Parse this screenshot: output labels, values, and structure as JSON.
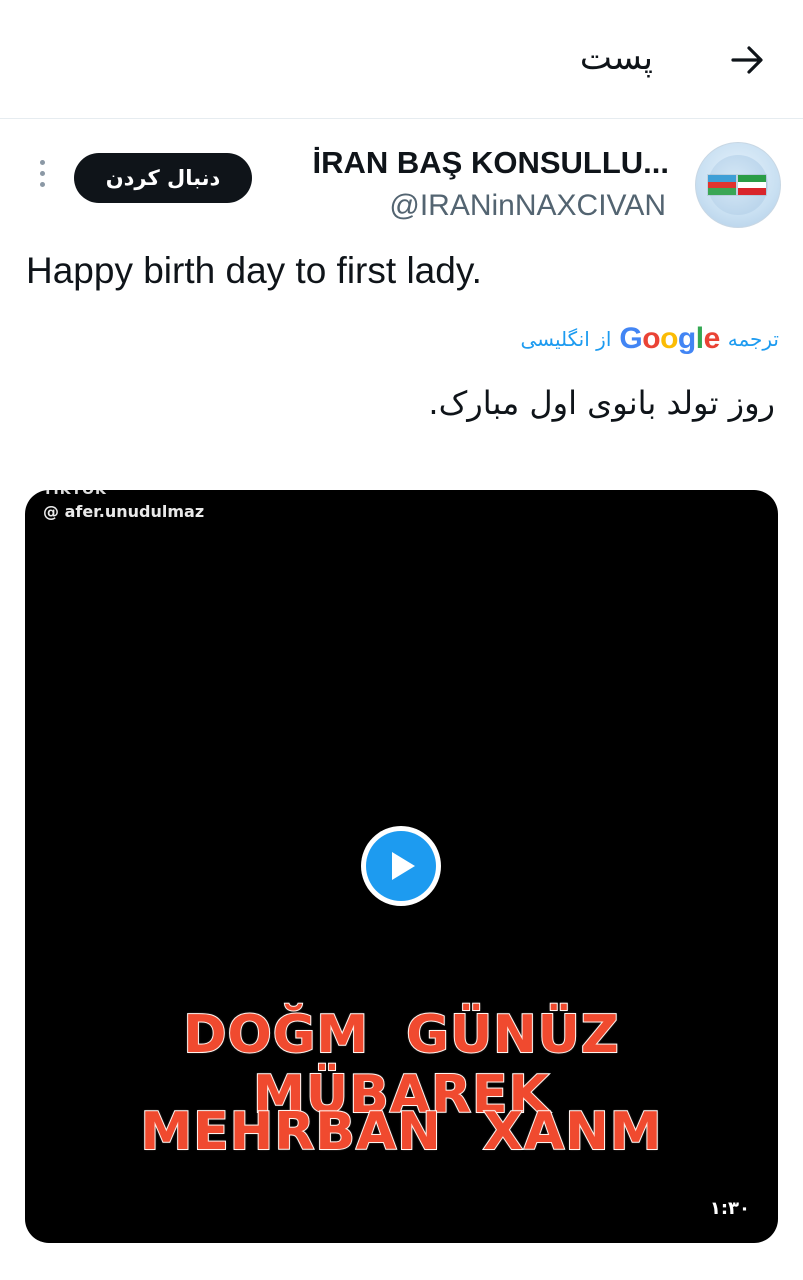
{
  "header": {
    "title": "پست",
    "back_icon": "arrow-right-icon"
  },
  "tweet": {
    "author_name": "İRAN BAŞ KONSULLU...",
    "author_handle": "@IRANinNAXCIVAN",
    "follow_label": "دنبال کردن",
    "more_icon": "more-vertical-icon",
    "text": "Happy birth day to first lady.",
    "translation": {
      "prefix": "ترجمه",
      "provider": "Google",
      "suffix": "از انگلیسی",
      "text": "روز تولد بانوی اول مبارک."
    },
    "media": {
      "watermark": "@ afer.unudulmaz",
      "top_cut_text": "TIKTOK",
      "caption_line1": "DOĞM GÜNÜZ MÜBAREK",
      "caption_line2": "MEHRBAN XANM",
      "duration": "۱:۳۰",
      "play_icon": "play-icon"
    }
  },
  "colors": {
    "accent": "#1d9bf0",
    "text": "#0f1419",
    "muted": "#536471",
    "caption": "#f04a2f"
  }
}
